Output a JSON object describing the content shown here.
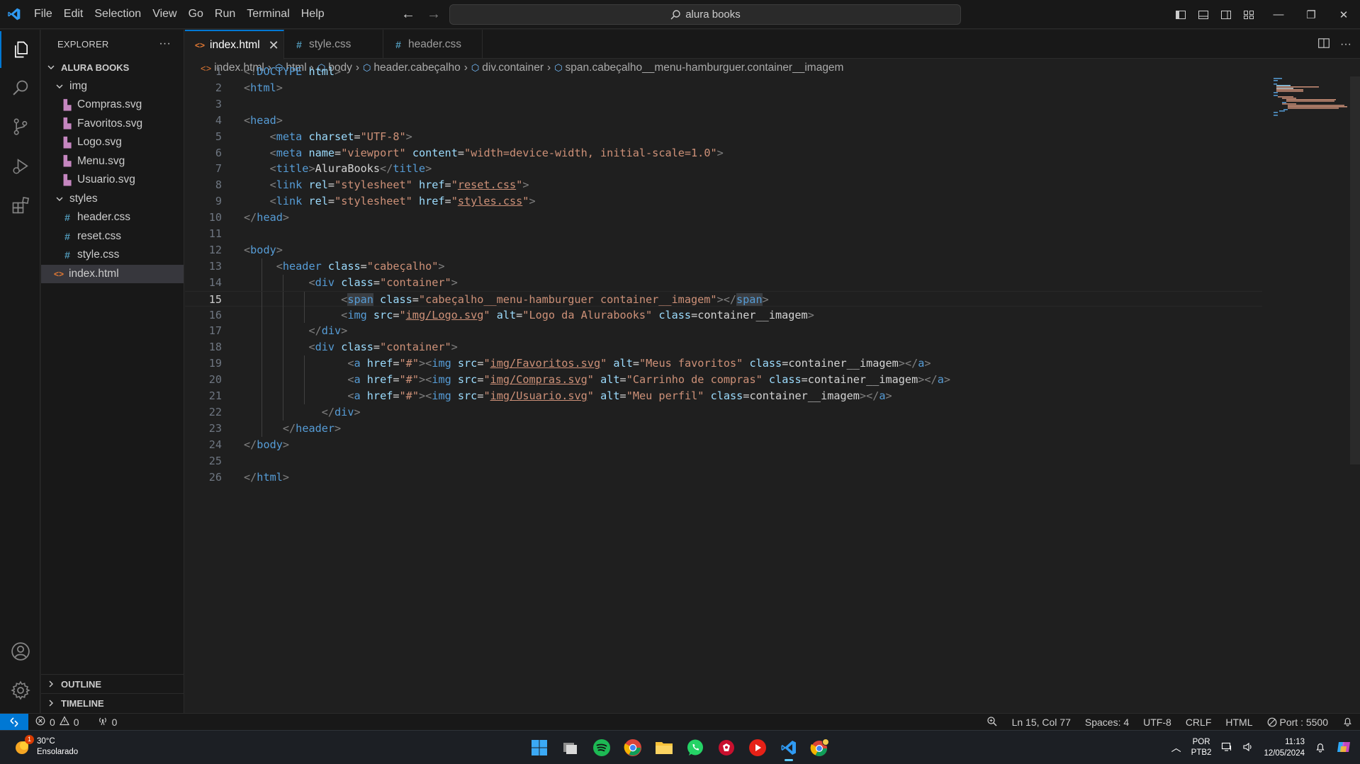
{
  "menu": [
    "File",
    "Edit",
    "Selection",
    "View",
    "Go",
    "Run",
    "Terminal",
    "Help"
  ],
  "search": {
    "text": "alura books"
  },
  "explorer": {
    "title": "EXPLORER",
    "more_label": "···",
    "project": "ALURA BOOKS",
    "folder_img": "img",
    "img_files": [
      "Compras.svg",
      "Favoritos.svg",
      "Logo.svg",
      "Menu.svg",
      "Usuario.svg"
    ],
    "folder_styles": "styles",
    "styles_files": [
      "header.css",
      "reset.css",
      "style.css"
    ],
    "root_file": "index.html",
    "outline": "OUTLINE",
    "timeline": "TIMELINE"
  },
  "tabs": [
    {
      "label": "index.html",
      "icon": "html-file-icon",
      "active": true
    },
    {
      "label": "style.css",
      "icon": "css-file-icon",
      "active": false
    },
    {
      "label": "header.css",
      "icon": "css-file-icon",
      "active": false
    }
  ],
  "tab_close": "✕",
  "breadcrumb": [
    "index.html",
    "html",
    "body",
    "header.cabeçalho",
    "div.container",
    "span.cabeçalho__menu-hamburguer.container__imagem"
  ],
  "code": {
    "current_line": 15,
    "lines": [
      "<!DOCTYPE html>",
      "<html>",
      "",
      "<head>",
      "    <meta charset=\"UTF-8\">",
      "    <meta name=\"viewport\" content=\"width=device-width, initial-scale=1.0\">",
      "    <title>AluraBooks</title>",
      "    <link rel=\"stylesheet\" href=\"reset.css\">",
      "    <link rel=\"stylesheet\" href=\"styles.css\">",
      "</head>",
      "",
      "<body>",
      "     <header class=\"cabeçalho\">",
      "          <div class=\"container\">",
      "               <span class=\"cabeçalho__menu-hamburguer container__imagem\"></span>",
      "               <img src=\"img/Logo.svg\" alt=\"Logo da Alurabooks\" class=container__imagem>",
      "          </div>",
      "          <div class=\"container\">",
      "                <a href=\"#\"><img src=\"img/Favoritos.svg\" alt=\"Meus favoritos\" class=container__imagem></a>",
      "                <a href=\"#\"><img src=\"img/Compras.svg\" alt=\"Carrinho de compras\" class=container__imagem></a>",
      "                <a href=\"#\"><img src=\"img/Usuario.svg\" alt=\"Meu perfil\" class=container__imagem></a>",
      "            </div>",
      "      </header>",
      "</body>",
      "",
      "</html>"
    ]
  },
  "status": {
    "errors": "0",
    "warnings": "0",
    "ports": "0",
    "position": "Ln 15, Col 77",
    "spaces": "Spaces: 4",
    "encoding": "UTF-8",
    "eol": "CRLF",
    "language": "HTML",
    "port": "Port : 5500"
  },
  "taskbar": {
    "temperature": "30°C",
    "weather": "Ensolarado",
    "weather_badge": "1",
    "lang_top": "POR",
    "lang_bottom": "PTB2",
    "time": "11:13",
    "date": "12/05/2024"
  },
  "colors": {
    "accent": "#0078d4",
    "tag": "#569cd6",
    "attribute": "#9cdcfe",
    "string": "#ce9178",
    "punctuation": "#808080"
  }
}
